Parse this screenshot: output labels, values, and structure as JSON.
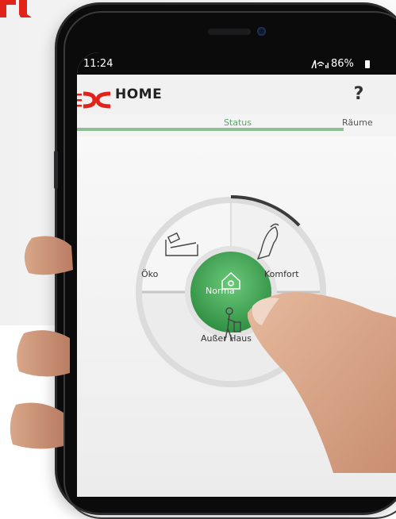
{
  "status_bar": {
    "time": "11:24",
    "icons": "N̸ ◔ .││",
    "battery": "86%"
  },
  "app": {
    "title": "HOME",
    "help": "?"
  },
  "tabs": [
    {
      "label": "Status",
      "active": true
    },
    {
      "label": "Räume",
      "active": false
    }
  ],
  "modes": {
    "oeko": "Öko",
    "komfort": "Komfort",
    "ausser_haus": "Außer Haus",
    "normal": "Norma"
  },
  "colors": {
    "accent_green": "#3a9c4d",
    "brand_red": "#e2231a",
    "tab_indicator": "#8dbf98"
  },
  "icons": [
    "bed-icon",
    "armchair-icon",
    "house-icon",
    "person-suitcase-icon",
    "help-icon"
  ]
}
